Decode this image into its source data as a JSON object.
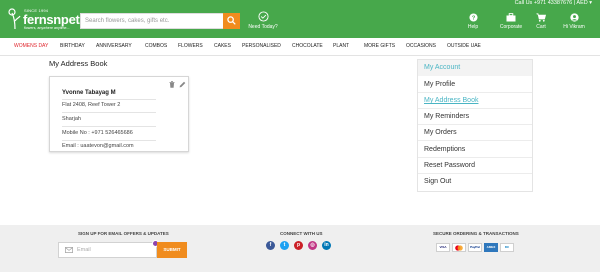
{
  "header": {
    "logo": {
      "since": "SINCE 1994",
      "brand": "fernsnpetals",
      "trademark": "™",
      "tagline": "flowers, anywhere anytime..."
    },
    "search": {
      "placeholder": "Search flowers, cakes, gifts etc."
    },
    "need_today": "Need Today?",
    "top_info": "Call Us +971 43387676  |  AED ▾",
    "icons": [
      {
        "name": "help",
        "label": "Help"
      },
      {
        "name": "corporate",
        "label": "Corporate"
      },
      {
        "name": "cart",
        "label": "Cart"
      },
      {
        "name": "user",
        "label": "Hi Vikram"
      }
    ]
  },
  "nav": {
    "items": [
      "WOMENS DAY",
      "BIRTHDAY",
      "ANNIVERSARY",
      "COMBOS",
      "FLOWERS",
      "CAKES",
      "PERSONALISED",
      "CHOCOLATE",
      "PLANT",
      "MORE GIFTS",
      "OCCASIONS",
      "OUTSIDE UAE"
    ],
    "active_index": 0
  },
  "address_book": {
    "title": "My Address Book",
    "card": {
      "name": "Yvonne Tabayag M",
      "address": "Flat 2408, Reef Tower 2",
      "city": "Sharjah",
      "mobile": "Mobile No :  +971 526465686",
      "email": "Email :  uaatevon@gmail.com"
    }
  },
  "account_menu": {
    "header": "My Account",
    "items": [
      "My Profile",
      "My Address Book",
      "My Reminders",
      "My Orders",
      "Redemptions",
      "Reset Password",
      "Sign Out"
    ],
    "active_index": 1
  },
  "footer": {
    "signup_title": "SIGN UP FOR EMAIL OFFERS & UPDATES",
    "email_placeholder": "Email",
    "submit_label": "SUBMIT",
    "connect_title": "CONNECT WITH US",
    "social": [
      "facebook",
      "twitter",
      "pinterest",
      "instagram",
      "linkedin"
    ],
    "secure_title": "SECURE ORDERING & TRANSACTIONS",
    "payments": [
      "VISA",
      "MC",
      "PayPal",
      "AMEX",
      "DC"
    ]
  },
  "colors": {
    "brand_green": "#47a84b",
    "accent_orange": "#f08c1e",
    "active_red": "#e0262d",
    "link_teal": "#4ab5c4"
  }
}
